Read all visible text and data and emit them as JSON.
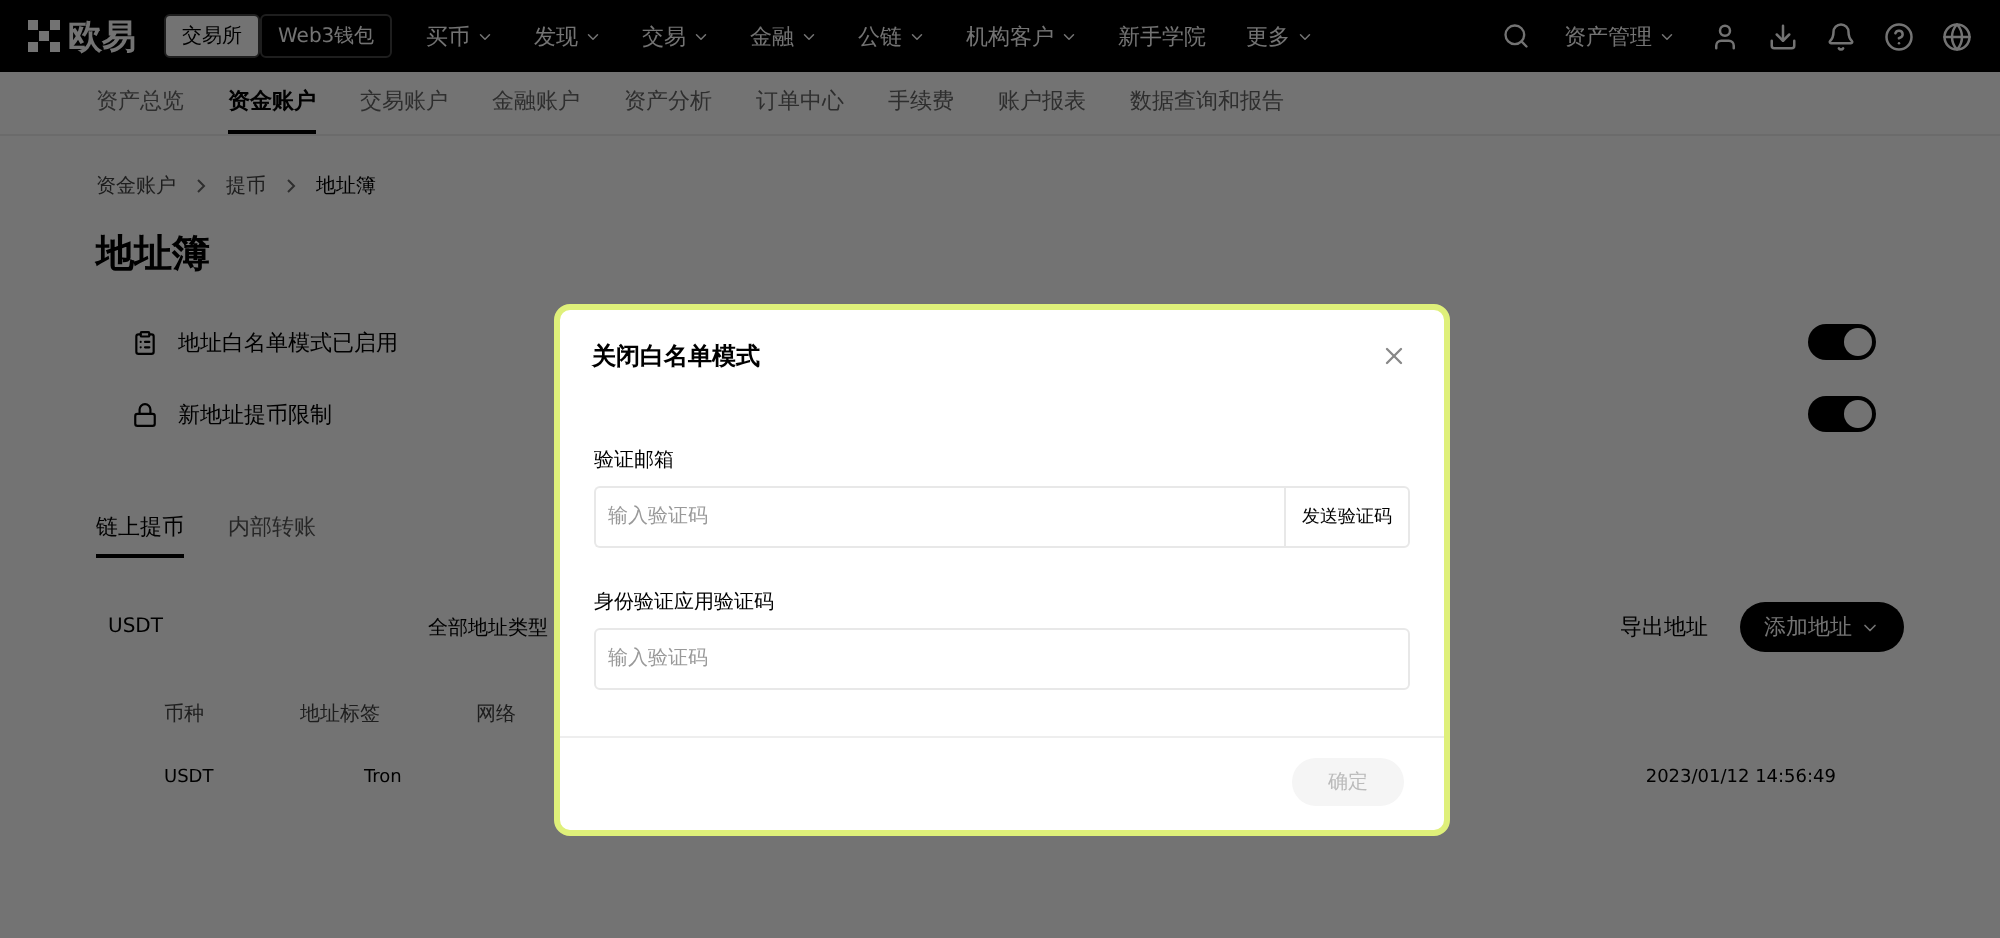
{
  "header": {
    "logo": "欧易",
    "modes": [
      {
        "label": "交易所",
        "selected": true
      },
      {
        "label": "Web3钱包",
        "selected": false
      }
    ],
    "nav": [
      {
        "label": "买币",
        "dropdown": true
      },
      {
        "label": "发现",
        "dropdown": true
      },
      {
        "label": "交易",
        "dropdown": true
      },
      {
        "label": "金融",
        "dropdown": true
      },
      {
        "label": "公链",
        "dropdown": true
      },
      {
        "label": "机构客户",
        "dropdown": true
      },
      {
        "label": "新手学院",
        "dropdown": false
      },
      {
        "label": "更多",
        "dropdown": true
      }
    ],
    "assets": "资产管理"
  },
  "subnav": [
    {
      "label": "资产总览",
      "selected": false
    },
    {
      "label": "资金账户",
      "selected": true
    },
    {
      "label": "交易账户",
      "selected": false
    },
    {
      "label": "金融账户",
      "selected": false
    },
    {
      "label": "资产分析",
      "selected": false
    },
    {
      "label": "订单中心",
      "selected": false
    },
    {
      "label": "手续费",
      "selected": false
    },
    {
      "label": "账户报表",
      "selected": false
    },
    {
      "label": "数据查询和报告",
      "selected": false
    }
  ],
  "breadcrumbs": [
    "资金账户",
    "提币",
    "地址簿"
  ],
  "title": "地址簿",
  "settings": [
    {
      "kind": "list",
      "title": "地址白名单模式已启用",
      "on": true
    },
    {
      "kind": "lock",
      "title": "新地址提币限制",
      "on": true
    }
  ],
  "tabs": [
    {
      "label": "链上提币",
      "selected": true
    },
    {
      "label": "内部转账",
      "selected": false
    }
  ],
  "filters": {
    "coin": "USDT",
    "type": "全部地址类型",
    "export": "导出地址",
    "add": "添加地址"
  },
  "table": {
    "columns": [
      "币种",
      "地址标签",
      "网络"
    ],
    "rows": [
      {
        "coin": "USDT",
        "network": "Tron",
        "time": "2023/01/12 14:56:49"
      }
    ]
  },
  "dialog": {
    "title": "关闭白名单模式",
    "fields": [
      {
        "label": "验证邮箱",
        "placeholder": "输入验证码",
        "action": "发送验证码"
      },
      {
        "label": "身份验证应用验证码",
        "placeholder": "输入验证码"
      }
    ],
    "confirm": "确定",
    "confirm_disabled": true
  }
}
